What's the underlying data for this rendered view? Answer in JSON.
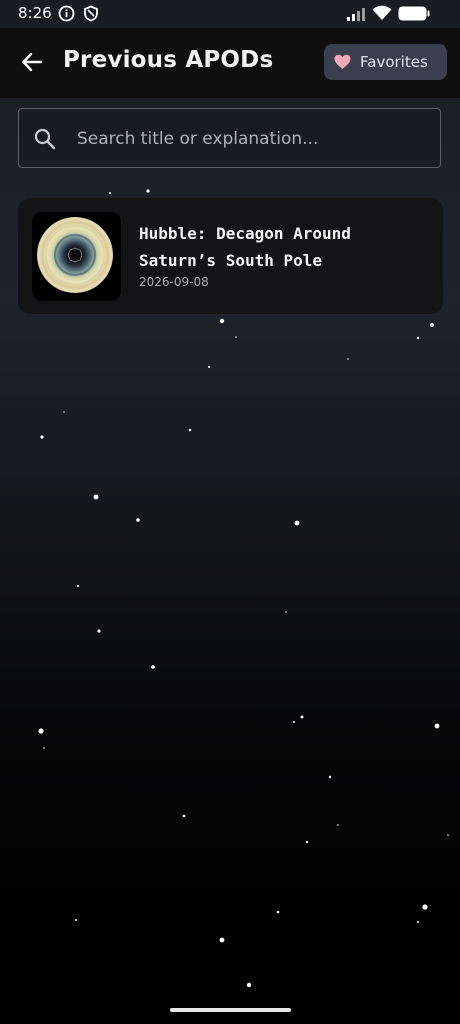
{
  "status_bar": {
    "time": "8:26",
    "icons": [
      "info-icon",
      "shield-icon",
      "signal-icon",
      "wifi-icon",
      "battery-icon"
    ]
  },
  "app_bar": {
    "title": "Previous APODs",
    "back_icon": "arrow-left-icon",
    "favorites_label": "Favorites",
    "favorites_icon": "heart-icon"
  },
  "search": {
    "placeholder": "Search title or explanation...",
    "value": ""
  },
  "apods": [
    {
      "title": "Hubble: Decagon Around Saturn’s South Pole",
      "date": "2026-09-08"
    }
  ],
  "colors": {
    "app_bar_bg": "#0f0f10",
    "favorites_bg": "#3a3f4e",
    "heart": "#f4a9b8",
    "card_bg": "#141416"
  }
}
